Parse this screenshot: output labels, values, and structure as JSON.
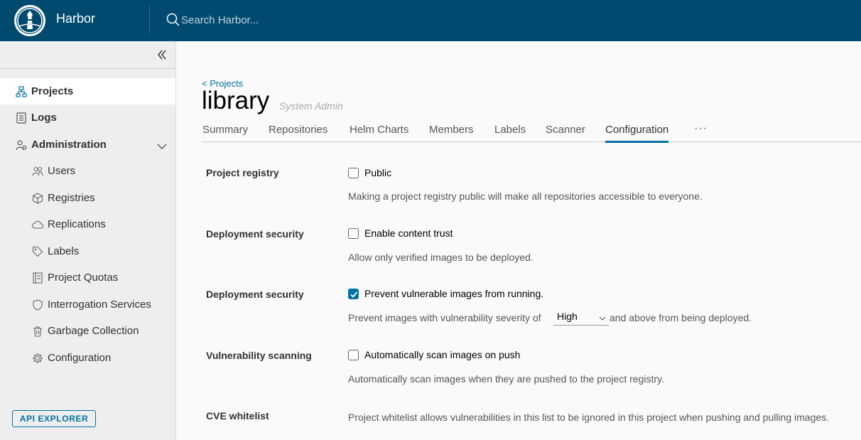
{
  "header": {
    "brand": "Harbor",
    "search_placeholder": "Search Harbor..."
  },
  "sidebar": {
    "items": [
      {
        "label": "Projects",
        "icon": "projects-icon"
      },
      {
        "label": "Logs",
        "icon": "logs-icon"
      },
      {
        "label": "Administration",
        "icon": "administration-icon"
      }
    ],
    "admin_items": [
      {
        "label": "Users",
        "icon": "users-icon"
      },
      {
        "label": "Registries",
        "icon": "registries-icon"
      },
      {
        "label": "Replications",
        "icon": "replications-icon"
      },
      {
        "label": "Labels",
        "icon": "labels-icon"
      },
      {
        "label": "Project Quotas",
        "icon": "project-quotas-icon"
      },
      {
        "label": "Interrogation Services",
        "icon": "interrogation-services-icon"
      },
      {
        "label": "Garbage Collection",
        "icon": "garbage-collection-icon"
      },
      {
        "label": "Configuration",
        "icon": "configuration-icon"
      }
    ],
    "api_explorer": "API EXPLORER"
  },
  "main": {
    "breadcrumb": "< Projects",
    "title": "library",
    "role": "System Admin",
    "tabs": [
      "Summary",
      "Repositories",
      "Helm Charts",
      "Members",
      "Labels",
      "Scanner",
      "Configuration"
    ],
    "active_tab": "Configuration",
    "more": "···",
    "sections": [
      {
        "label": "Project registry",
        "checkbox": "Public",
        "checked": false,
        "help": "Making a project registry public will make all repositories accessible to everyone."
      },
      {
        "label": "Deployment security",
        "checkbox": "Enable content trust",
        "checked": false,
        "help": "Allow only verified images to be deployed."
      },
      {
        "label": "Deployment security",
        "checkbox": "Prevent vulnerable images from running.",
        "checked": true,
        "help_prefix": "Prevent images with vulnerability severity of",
        "severity": "High",
        "help_suffix": "and above from being deployed."
      },
      {
        "label": "Vulnerability scanning",
        "checkbox": "Automatically scan images on push",
        "checked": false,
        "help": "Automatically scan images when they are pushed to the project registry."
      },
      {
        "label": "CVE whitelist",
        "help": "Project whitelist allows vulnerabilities in this list to be ignored in this project when pushing and pulling images."
      }
    ]
  },
  "colors": {
    "header_bg": "#004a70",
    "accent": "#0072a3",
    "sidebar_bg": "#eeeeee"
  }
}
